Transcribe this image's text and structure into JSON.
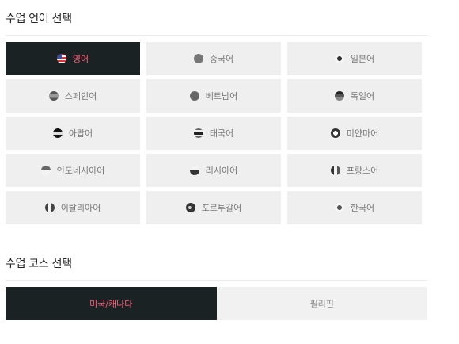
{
  "language_section": {
    "title": "수업 언어 선택"
  },
  "languages": [
    {
      "label": "영어",
      "icon": "us-flag-icon",
      "active": true
    },
    {
      "label": "중국어",
      "icon": "china-flag-icon",
      "active": false
    },
    {
      "label": "일본어",
      "icon": "japan-flag-icon",
      "active": false
    },
    {
      "label": "스페인어",
      "icon": "spain-flag-icon",
      "active": false
    },
    {
      "label": "베트남어",
      "icon": "vietnam-flag-icon",
      "active": false
    },
    {
      "label": "독일어",
      "icon": "germany-flag-icon",
      "active": false
    },
    {
      "label": "아랍어",
      "icon": "arab-flag-icon",
      "active": false
    },
    {
      "label": "태국어",
      "icon": "thailand-flag-icon",
      "active": false
    },
    {
      "label": "미얀마어",
      "icon": "myanmar-flag-icon",
      "active": false
    },
    {
      "label": "인도네시아어",
      "icon": "indonesia-flag-icon",
      "active": false
    },
    {
      "label": "러시아어",
      "icon": "russia-flag-icon",
      "active": false
    },
    {
      "label": "프랑스어",
      "icon": "france-flag-icon",
      "active": false
    },
    {
      "label": "이탈리아어",
      "icon": "italy-flag-icon",
      "active": false
    },
    {
      "label": "포르투갈어",
      "icon": "portugal-flag-icon",
      "active": false
    },
    {
      "label": "한국어",
      "icon": "korea-flag-icon",
      "active": false
    }
  ],
  "course_section": {
    "title": "수업 코스 선택"
  },
  "courses": [
    {
      "label": "미국/캐나다",
      "active": true
    },
    {
      "label": "필리핀",
      "active": false
    }
  ],
  "colors": {
    "active_bg": "#1a2224",
    "active_text": "#ff5a75",
    "inactive_bg": "#efefef",
    "inactive_text": "#777777"
  }
}
